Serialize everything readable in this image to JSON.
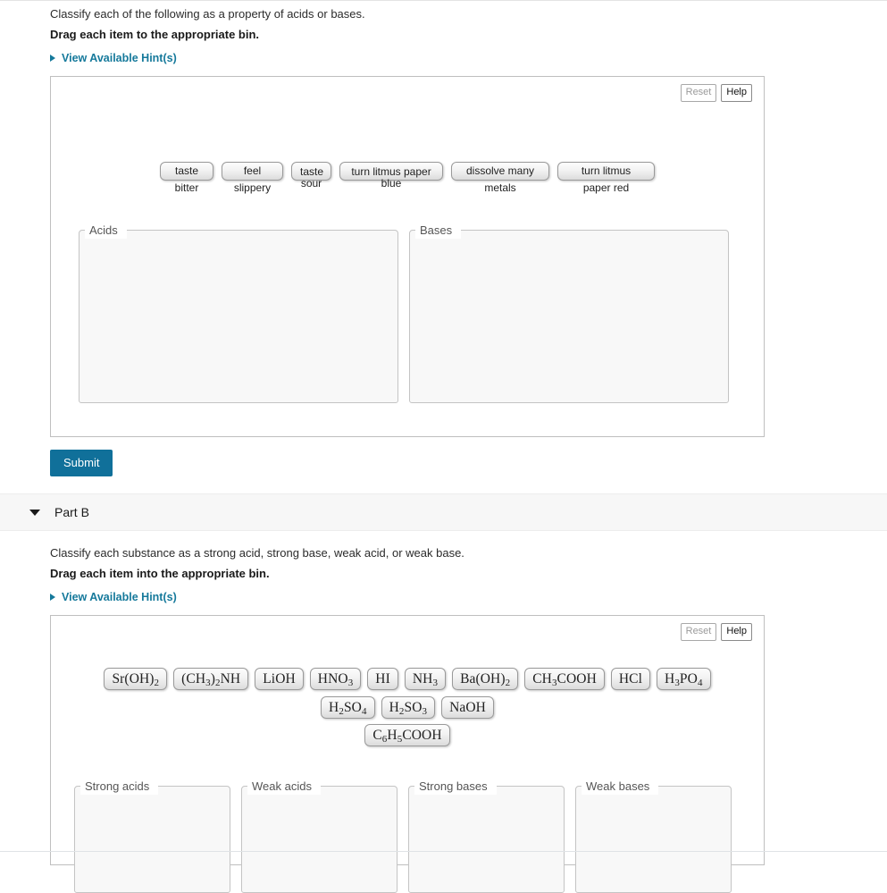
{
  "part_a": {
    "prompt": "Classify each of the following as a property of acids or bases.",
    "instruction": "Drag each item to the appropriate bin.",
    "hint_link": "View Available Hint(s)",
    "tools": {
      "reset_label": "Reset",
      "help_label": "Help"
    },
    "items": [
      {
        "label": "taste bitter",
        "lines": 1
      },
      {
        "label": "feel slippery",
        "lines": 1
      },
      {
        "label": "taste sour",
        "lines": 2
      },
      {
        "label": "turn litmus paper blue",
        "lines": 2
      },
      {
        "label": "dissolve many metals",
        "lines": 1
      },
      {
        "label": "turn litmus paper red",
        "lines": 1
      }
    ],
    "bins": [
      {
        "label": "Acids",
        "contents": []
      },
      {
        "label": "Bases",
        "contents": []
      }
    ],
    "submit_label": "Submit"
  },
  "part_b": {
    "header_title": "Part B",
    "prompt": "Classify each substance as a strong acid, strong base, weak acid, or weak base.",
    "instruction": "Drag each item into the appropriate bin.",
    "hint_link": "View Available Hint(s)",
    "tools": {
      "reset_label": "Reset",
      "help_label": "Help"
    },
    "items_row1": [
      {
        "html": "Sr(OH)<sub>2</sub>",
        "text": "Sr(OH)2"
      },
      {
        "html": "(CH<sub>3</sub>)<sub>2</sub>NH",
        "text": "(CH3)2NH"
      },
      {
        "html": "LiOH",
        "text": "LiOH"
      },
      {
        "html": "HNO<sub>3</sub>",
        "text": "HNO3"
      },
      {
        "html": "HI",
        "text": "HI"
      },
      {
        "html": "NH<sub>3</sub>",
        "text": "NH3"
      },
      {
        "html": "Ba(OH)<sub>2</sub>",
        "text": "Ba(OH)2"
      },
      {
        "html": "CH<sub>3</sub>COOH",
        "text": "CH3COOH"
      },
      {
        "html": "HCl",
        "text": "HCl"
      },
      {
        "html": "H<sub>3</sub>PO<sub>4</sub>",
        "text": "H3PO4"
      },
      {
        "html": "H<sub>2</sub>SO<sub>4</sub>",
        "text": "H2SO4"
      },
      {
        "html": "H<sub>2</sub>SO<sub>3</sub>",
        "text": "H2SO3"
      },
      {
        "html": "NaOH",
        "text": "NaOH"
      }
    ],
    "items_row2": [
      {
        "html": "C<sub>6</sub>H<sub>5</sub>COOH",
        "text": "C6H5COOH"
      }
    ],
    "bins": [
      {
        "label": "Strong acids",
        "contents": []
      },
      {
        "label": "Weak acids",
        "contents": []
      },
      {
        "label": "Strong bases",
        "contents": []
      },
      {
        "label": "Weak bases",
        "contents": []
      }
    ]
  },
  "colors": {
    "link": "#15799b",
    "submit_bg": "#10709a",
    "bin_bg": "#f8f8f8",
    "part_header_bg": "#f7f7f7"
  }
}
